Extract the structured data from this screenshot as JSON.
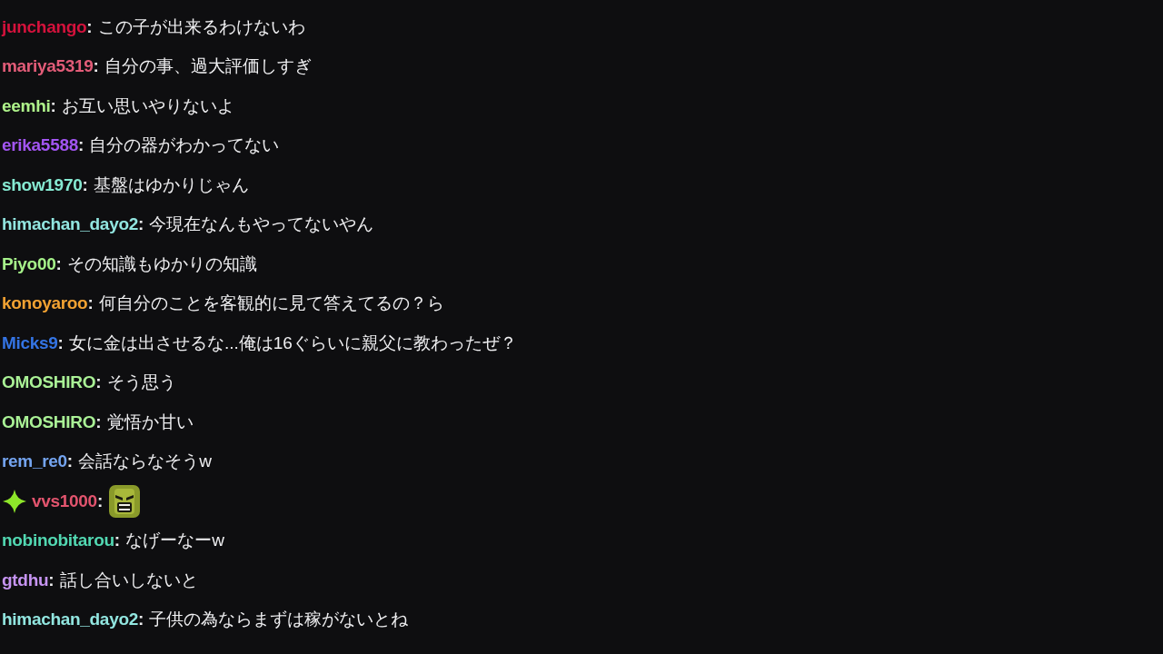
{
  "messages": [
    {
      "user": "junchango",
      "sep": ":",
      "color": "#d4123c",
      "badge": false,
      "kind": "text",
      "text": "この子が出来るわけないわ"
    },
    {
      "user": "mariya5319",
      "sep": ":",
      "color": "#e25c78",
      "badge": false,
      "kind": "text",
      "text": "自分の事、過大評価しすぎ"
    },
    {
      "user": "eemhi",
      "sep": ":",
      "color": "#aef28a",
      "badge": false,
      "kind": "text",
      "text": "お互い思いやりないよ"
    },
    {
      "user": "erika5588",
      "sep": ":",
      "color": "#a255f2",
      "badge": false,
      "kind": "text",
      "text": "自分の器がわかってない"
    },
    {
      "user": "show1970",
      "sep": ":",
      "color": "#86ead2",
      "badge": false,
      "kind": "text",
      "text": "基盤はゆかりじゃん"
    },
    {
      "user": "himachan_dayo2",
      "sep": ":",
      "color": "#92e6e0",
      "badge": false,
      "kind": "text",
      "text": "今現在なんもやってないやん"
    },
    {
      "user": "Piyo00",
      "sep": ":",
      "color": "#a6f28a",
      "badge": false,
      "kind": "text",
      "text": "その知識もゆかりの知識"
    },
    {
      "user": "konoyaroo",
      "sep": ":",
      "color": "#f2a232",
      "badge": false,
      "kind": "text",
      "text": "何自分のことを客観的に見て答えてるの？ら"
    },
    {
      "user": "Micks9",
      "sep": ":",
      "color": "#3474e4",
      "badge": false,
      "kind": "text",
      "text": "女に金は出させるな...俺は16ぐらいに親父に教わったぜ？"
    },
    {
      "user": "OMOSHIRO",
      "sep": ":",
      "color": "#aaf296",
      "badge": false,
      "kind": "text",
      "text": "そう思う"
    },
    {
      "user": "OMOSHIRO",
      "sep": ":",
      "color": "#aaf296",
      "badge": false,
      "kind": "text",
      "text": "覚悟か甘い"
    },
    {
      "user": "rem_re0",
      "sep": ":",
      "color": "#74a4f0",
      "badge": false,
      "kind": "text",
      "text": "会話ならなそうw"
    },
    {
      "user": "vvs1000",
      "sep": ":",
      "color": "#e2546e",
      "badge": true,
      "kind": "emote"
    },
    {
      "user": "nobinobitarou",
      "sep": ":",
      "color": "#52d8b2",
      "badge": false,
      "kind": "text",
      "text": "なげーなーw"
    },
    {
      "user": "gtdhu",
      "sep": ":",
      "color": "#c694f2",
      "badge": false,
      "kind": "text",
      "text": "話し合いしないと"
    },
    {
      "user": "himachan_dayo2",
      "sep": ":",
      "color": "#92e6e0",
      "badge": false,
      "kind": "text",
      "text": "子供の為ならまずは稼がないとね"
    }
  ]
}
